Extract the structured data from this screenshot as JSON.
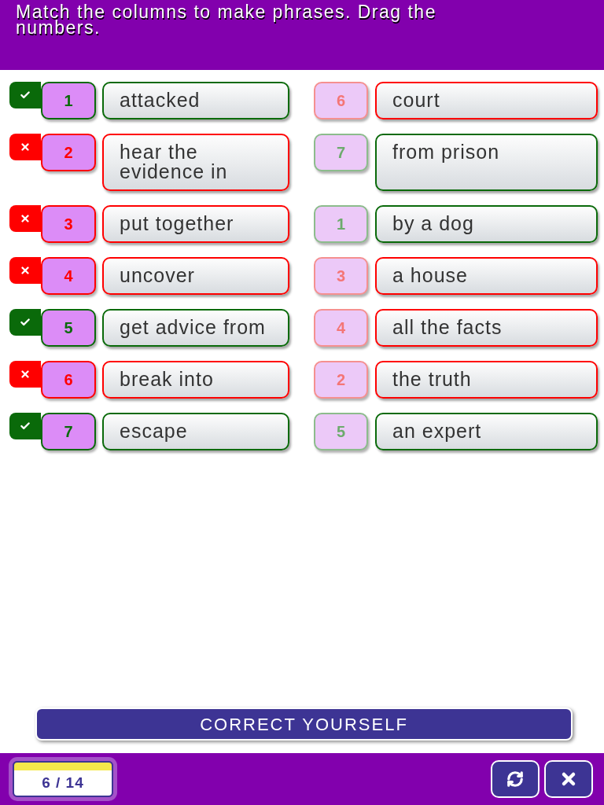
{
  "header": {
    "instruction": "Match the columns to make phrases. Drag the numbers."
  },
  "left_column": [
    {
      "number": "1",
      "text": "attacked",
      "correct": true
    },
    {
      "number": "2",
      "text": "hear the evidence in",
      "correct": false
    },
    {
      "number": "3",
      "text": "put together",
      "correct": false
    },
    {
      "number": "4",
      "text": "uncover",
      "correct": false
    },
    {
      "number": "5",
      "text": "get advice from",
      "correct": true
    },
    {
      "number": "6",
      "text": "break into",
      "correct": false
    },
    {
      "number": "7",
      "text": "escape",
      "correct": true
    }
  ],
  "right_column": [
    {
      "number": "6",
      "text": "court",
      "correct": false
    },
    {
      "number": "7",
      "text": "from prison",
      "correct": true
    },
    {
      "number": "1",
      "text": "by a dog",
      "correct": true
    },
    {
      "number": "3",
      "text": "a house",
      "correct": false
    },
    {
      "number": "4",
      "text": "all the facts",
      "correct": false
    },
    {
      "number": "2",
      "text": "the truth",
      "correct": false
    },
    {
      "number": "5",
      "text": "an expert",
      "correct": true
    }
  ],
  "check_button": {
    "label": "CORRECT YOURSELF"
  },
  "footer": {
    "counter": "6 / 14"
  }
}
